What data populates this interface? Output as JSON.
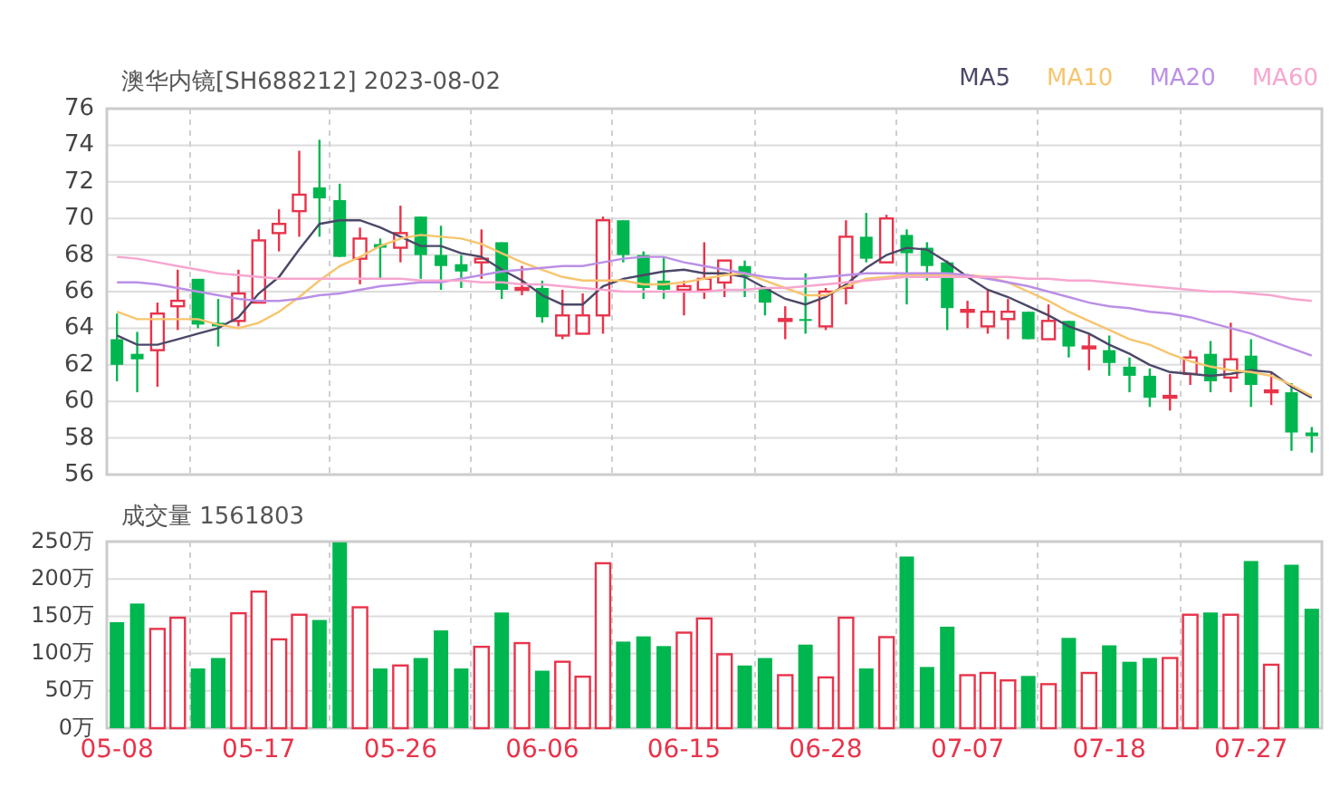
{
  "price_chart": {
    "chart_data": {
      "type": "candlestick",
      "title": "澳华内镜[SH688212] 2023-08-02",
      "grid": true,
      "ylim": [
        56,
        76
      ],
      "yticks": [
        56,
        58,
        60,
        62,
        64,
        66,
        68,
        70,
        72,
        74,
        76
      ],
      "categories": [
        null,
        null,
        null,
        null,
        null,
        null,
        null,
        null,
        null,
        null,
        null,
        null,
        null,
        null,
        null,
        null,
        null,
        null,
        null,
        null,
        null,
        null,
        null,
        null,
        null,
        null,
        null,
        null,
        null,
        null,
        null,
        null,
        null,
        null,
        null,
        null,
        null,
        null,
        null,
        null,
        null,
        null,
        null,
        null,
        null,
        null,
        null,
        null,
        null,
        null,
        null,
        null,
        null,
        null,
        null,
        null,
        null,
        null,
        null,
        null
      ],
      "ohlc": [
        [
          63.4,
          64.8,
          61.1,
          62.0
        ],
        [
          62.6,
          63.8,
          60.5,
          62.3
        ],
        [
          62.8,
          65.4,
          60.8,
          64.8
        ],
        [
          65.2,
          67.2,
          63.9,
          65.5
        ],
        [
          66.7,
          66.7,
          64.0,
          64.2
        ],
        [
          64.3,
          65.6,
          63.0,
          64.1
        ],
        [
          64.4,
          67.2,
          64.1,
          65.9
        ],
        [
          65.4,
          69.4,
          65.4,
          68.8
        ],
        [
          69.2,
          70.5,
          68.2,
          69.7
        ],
        [
          70.4,
          73.7,
          69.0,
          71.3
        ],
        [
          71.7,
          74.3,
          69.0,
          71.1
        ],
        [
          71.0,
          71.9,
          67.9,
          67.9
        ],
        [
          67.8,
          69.5,
          66.4,
          68.9
        ],
        [
          68.6,
          68.9,
          66.7,
          68.4
        ],
        [
          68.4,
          70.7,
          67.6,
          69.2
        ],
        [
          70.1,
          70.1,
          66.7,
          68.0
        ],
        [
          68.0,
          69.6,
          66.1,
          67.4
        ],
        [
          67.5,
          68.0,
          66.2,
          67.1
        ],
        [
          67.6,
          69.4,
          66.7,
          67.8
        ],
        [
          68.7,
          68.7,
          65.6,
          66.1
        ],
        [
          66.1,
          67.4,
          65.8,
          66.2
        ],
        [
          66.2,
          66.6,
          64.3,
          64.6
        ],
        [
          63.6,
          66.1,
          63.4,
          64.7
        ],
        [
          63.7,
          65.9,
          63.7,
          64.7
        ],
        [
          64.7,
          70.1,
          63.7,
          69.9
        ],
        [
          69.9,
          69.9,
          67.6,
          68.0
        ],
        [
          68.0,
          68.2,
          65.6,
          66.2
        ],
        [
          66.6,
          67.9,
          65.6,
          66.1
        ],
        [
          66.1,
          66.6,
          64.7,
          66.3
        ],
        [
          66.1,
          68.7,
          65.6,
          66.7
        ],
        [
          66.5,
          67.7,
          65.7,
          67.7
        ],
        [
          67.4,
          67.7,
          65.7,
          66.8
        ],
        [
          66.2,
          66.3,
          64.7,
          65.4
        ],
        [
          64.4,
          65.2,
          63.4,
          64.5
        ],
        [
          64.5,
          67.0,
          63.7,
          64.4
        ],
        [
          64.1,
          66.2,
          63.9,
          66.0
        ],
        [
          66.2,
          69.9,
          65.3,
          69.0
        ],
        [
          69.0,
          70.3,
          67.6,
          67.8
        ],
        [
          67.6,
          70.2,
          67.6,
          70.0
        ],
        [
          69.1,
          69.4,
          65.3,
          68.1
        ],
        [
          68.4,
          68.7,
          66.6,
          67.4
        ],
        [
          67.6,
          67.7,
          63.9,
          65.1
        ],
        [
          64.9,
          65.5,
          64.0,
          65.0
        ],
        [
          64.1,
          66.1,
          63.7,
          64.9
        ],
        [
          64.5,
          65.6,
          63.4,
          64.9
        ],
        [
          64.9,
          64.9,
          63.4,
          63.4
        ],
        [
          63.4,
          65.3,
          63.4,
          64.4
        ],
        [
          64.4,
          64.4,
          62.4,
          63.0
        ],
        [
          62.9,
          63.7,
          61.7,
          63.0
        ],
        [
          62.8,
          63.6,
          61.4,
          62.1
        ],
        [
          61.9,
          62.4,
          60.5,
          61.4
        ],
        [
          61.4,
          61.8,
          59.7,
          60.2
        ],
        [
          60.2,
          61.5,
          59.5,
          60.3
        ],
        [
          61.5,
          62.8,
          60.9,
          62.4
        ],
        [
          62.6,
          63.3,
          60.5,
          61.1
        ],
        [
          61.3,
          64.3,
          60.5,
          62.3
        ],
        [
          62.5,
          63.4,
          59.7,
          60.9
        ],
        [
          60.5,
          61.6,
          59.8,
          60.6
        ],
        [
          60.5,
          61.0,
          57.3,
          58.3
        ],
        [
          58.3,
          58.6,
          57.2,
          58.1
        ]
      ],
      "series": [
        {
          "name": "MA5",
          "type": "line",
          "color": "#4b4868",
          "values": [
            63.6,
            63.1,
            63.1,
            63.4,
            63.7,
            64.0,
            64.6,
            65.9,
            66.8,
            68.3,
            69.7,
            69.9,
            69.9,
            69.5,
            69.0,
            68.5,
            68.5,
            68.1,
            67.9,
            67.2,
            66.6,
            65.8,
            65.3,
            65.3,
            66.3,
            66.7,
            66.9,
            67.1,
            67.2,
            67.0,
            67.0,
            66.8,
            66.2,
            65.6,
            65.3,
            65.7,
            66.4,
            67.3,
            68.0,
            68.4,
            68.3,
            67.6,
            66.8,
            66.1,
            65.7,
            65.2,
            64.7,
            64.1,
            63.7,
            63.1,
            62.6,
            62.0,
            61.6,
            61.5,
            61.4,
            61.5,
            61.7,
            61.6,
            60.8,
            60.2
          ]
        },
        {
          "name": "MA10",
          "type": "line",
          "color": "#f7c56e",
          "values": [
            64.9,
            64.5,
            64.5,
            64.5,
            64.5,
            64.2,
            64.0,
            64.3,
            64.9,
            65.7,
            66.6,
            67.4,
            67.9,
            68.5,
            68.9,
            69.1,
            69.0,
            68.9,
            68.6,
            68.1,
            67.6,
            67.2,
            66.8,
            66.6,
            66.6,
            66.6,
            66.4,
            66.4,
            66.5,
            66.7,
            66.9,
            67.0,
            66.6,
            66.2,
            65.8,
            65.8,
            66.3,
            66.7,
            66.8,
            66.9,
            66.9,
            66.9,
            66.9,
            66.8,
            66.5,
            66.0,
            65.5,
            64.9,
            64.4,
            63.9,
            63.4,
            63.1,
            62.6,
            62.2,
            61.9,
            61.7,
            61.6,
            61.4,
            60.9,
            60.3
          ]
        },
        {
          "name": "MA20",
          "type": "line",
          "color": "#bb8fe6",
          "values": [
            66.5,
            66.5,
            66.4,
            66.2,
            66.0,
            65.8,
            65.6,
            65.5,
            65.5,
            65.6,
            65.8,
            65.9,
            66.1,
            66.3,
            66.4,
            66.5,
            66.5,
            66.7,
            66.9,
            67.1,
            67.2,
            67.3,
            67.4,
            67.4,
            67.6,
            67.8,
            67.9,
            67.9,
            67.6,
            67.4,
            67.2,
            67.0,
            66.8,
            66.7,
            66.7,
            66.8,
            66.9,
            67.0,
            67.0,
            67.0,
            67.0,
            67.0,
            66.9,
            66.7,
            66.5,
            66.3,
            66.0,
            65.7,
            65.4,
            65.2,
            65.1,
            64.9,
            64.8,
            64.6,
            64.3,
            64.0,
            63.7,
            63.3,
            62.9,
            62.5
          ]
        },
        {
          "name": "MA60",
          "type": "line",
          "color": "#f7a6cf",
          "values": [
            67.9,
            67.8,
            67.6,
            67.4,
            67.2,
            67.0,
            66.9,
            66.8,
            66.7,
            66.7,
            66.7,
            66.7,
            66.7,
            66.7,
            66.7,
            66.6,
            66.6,
            66.6,
            66.5,
            66.5,
            66.4,
            66.4,
            66.3,
            66.2,
            66.1,
            66.0,
            66.0,
            66.0,
            66.0,
            66.0,
            66.1,
            66.1,
            66.2,
            66.2,
            66.3,
            66.4,
            66.5,
            66.6,
            66.7,
            66.8,
            66.8,
            66.8,
            66.8,
            66.8,
            66.8,
            66.7,
            66.7,
            66.6,
            66.6,
            66.5,
            66.4,
            66.3,
            66.2,
            66.1,
            66.0,
            66.0,
            65.9,
            65.8,
            65.6,
            65.5
          ]
        }
      ]
    }
  },
  "volume_chart": {
    "chart_data": {
      "type": "bar",
      "title": "成交量 1561803",
      "grid": true,
      "ylim": [
        0,
        250
      ],
      "yticks": [
        {
          "value": 0,
          "label": "0万"
        },
        {
          "value": 50,
          "label": "50万"
        },
        {
          "value": 100,
          "label": "100万"
        },
        {
          "value": 150,
          "label": "150万"
        },
        {
          "value": 200,
          "label": "200万"
        },
        {
          "value": 250,
          "label": "250万"
        }
      ],
      "categories": [
        "05-08",
        null,
        null,
        null,
        null,
        null,
        null,
        "05-17",
        null,
        null,
        null,
        null,
        null,
        null,
        "05-26",
        null,
        null,
        null,
        null,
        null,
        null,
        "06-06",
        null,
        null,
        null,
        null,
        null,
        null,
        "06-15",
        null,
        null,
        null,
        null,
        null,
        null,
        "06-28",
        null,
        null,
        null,
        null,
        null,
        null,
        "07-07",
        null,
        null,
        null,
        null,
        null,
        null,
        "07-18",
        null,
        null,
        null,
        null,
        null,
        null,
        "07-27",
        null,
        null,
        null
      ],
      "values": [
        142,
        167,
        133,
        148,
        80,
        94,
        154,
        183,
        119,
        152,
        145,
        249,
        162,
        80,
        84,
        94,
        131,
        80,
        109,
        155,
        114,
        77,
        89,
        69,
        221,
        116,
        123,
        110,
        128,
        147,
        99,
        84,
        94,
        71,
        112,
        68,
        148,
        80,
        122,
        230,
        82,
        136,
        71,
        74,
        64,
        70,
        59,
        121,
        74,
        111,
        89,
        94,
        94,
        152,
        155,
        152,
        224,
        85,
        219,
        160
      ]
    }
  }
}
